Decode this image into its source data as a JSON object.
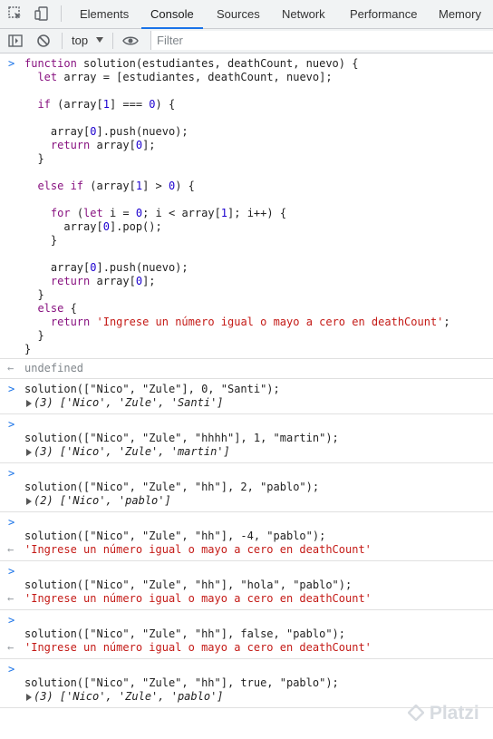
{
  "tabs": [
    "Elements",
    "Console",
    "Sources",
    "Network",
    "Performance",
    "Memory"
  ],
  "toolbar": {
    "context": "top",
    "filter_placeholder": "Filter"
  },
  "code": [
    "function solution(estudiantes, deathCount, nuevo) {",
    "  let array = [estudiantes, deathCount, nuevo];",
    "",
    "  if (array[1] === 0) {",
    "",
    "    array[0].push(nuevo);",
    "    return array[0];",
    "  }",
    "",
    "  else if (array[1] > 0) {",
    "",
    "    for (let i = 0; i < array[1]; i++) {",
    "      array[0].pop();",
    "    }",
    "",
    "    array[0].push(nuevo);",
    "    return array[0];",
    "  }",
    "  else {",
    "    return 'Ingrese un número igual o mayo a cero en deathCount';",
    "  }",
    "}"
  ],
  "undefined_label": "undefined",
  "calls": [
    {
      "input": "solution([\"Nico\", \"Zule\"], 0, \"Santi\");",
      "output": "(3) ['Nico', 'Zule', 'Santi']",
      "kind": "array"
    },
    {
      "input": "solution([\"Nico\", \"Zule\", \"hhhh\"], 1, \"martin\");",
      "output": "(3) ['Nico', 'Zule', 'martin']",
      "kind": "array"
    },
    {
      "input": "solution([\"Nico\", \"Zule\", \"hh\"], 2, \"pablo\");",
      "output": "(2) ['Nico', 'pablo']",
      "kind": "array"
    },
    {
      "input": "solution([\"Nico\", \"Zule\", \"hh\"], -4, \"pablo\");",
      "output": "'Ingrese un número igual o mayo a cero en deathCount'",
      "kind": "string"
    },
    {
      "input": "solution([\"Nico\", \"Zule\", \"hh\"], \"hola\", \"pablo\");",
      "output": "'Ingrese un número igual o mayo a cero en deathCount'",
      "kind": "string"
    },
    {
      "input": "solution([\"Nico\", \"Zule\", \"hh\"], false, \"pablo\");",
      "output": "'Ingrese un número igual o mayo a cero en deathCount'",
      "kind": "string"
    },
    {
      "input": "solution([\"Nico\", \"Zule\", \"hh\"], true, \"pablo\");",
      "output": "(3) ['Nico', 'Zule', 'pablo']",
      "kind": "array"
    }
  ],
  "watermark": "Platzi"
}
